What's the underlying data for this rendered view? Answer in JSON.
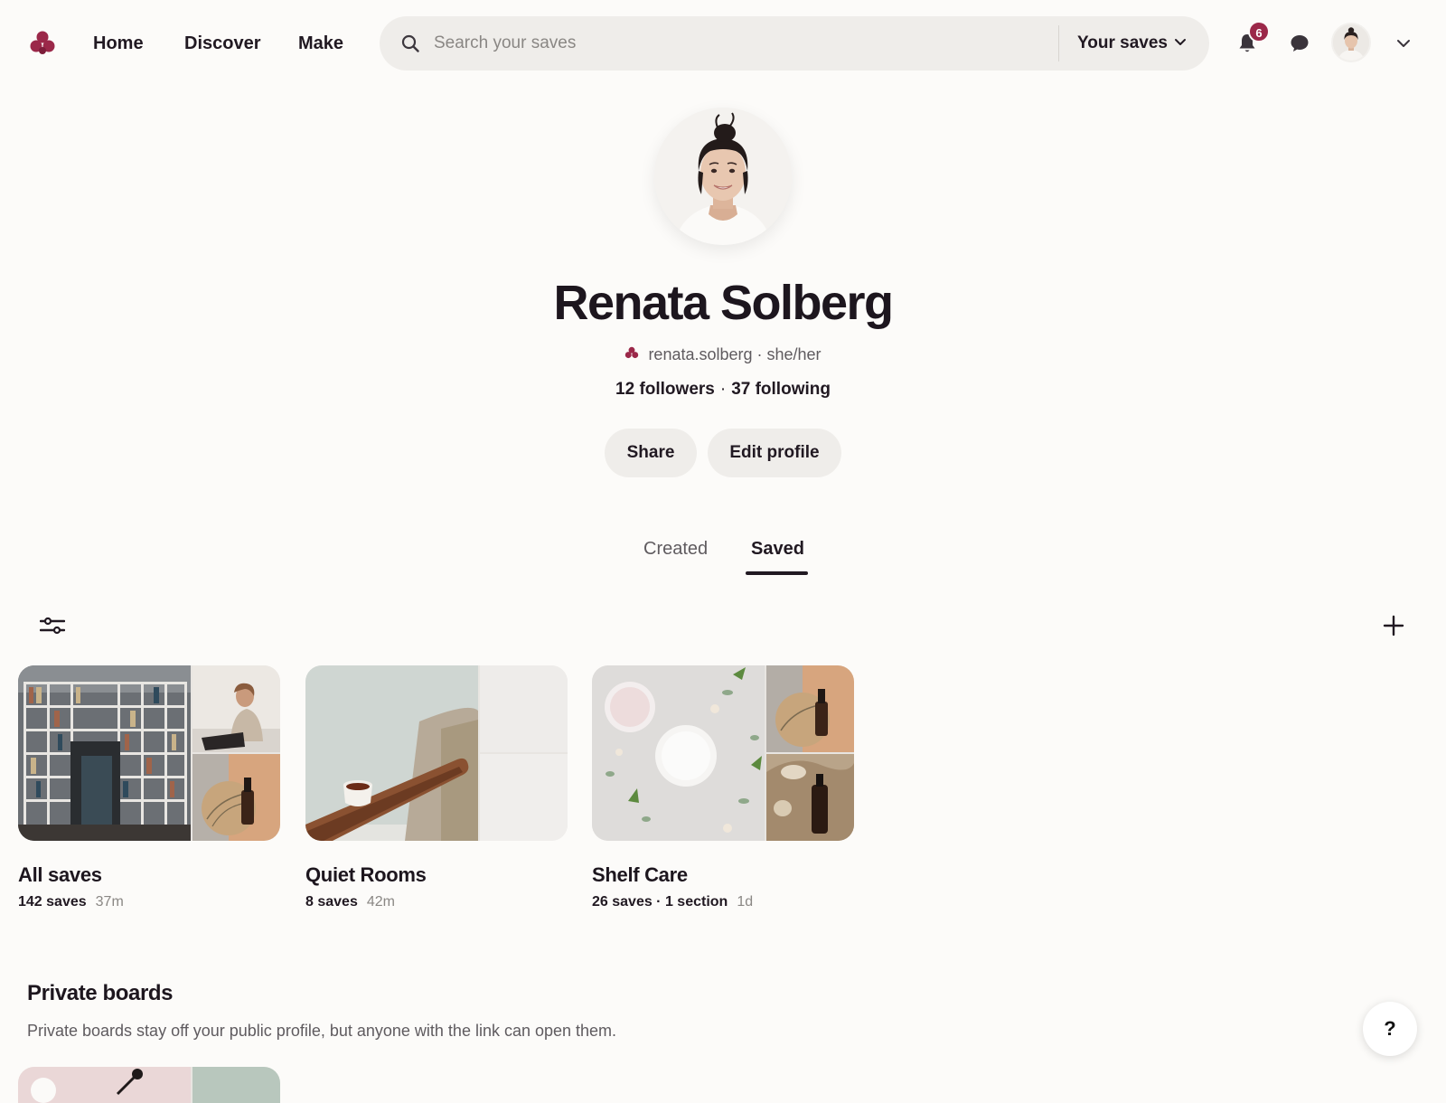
{
  "header": {
    "nav": [
      {
        "label": "Home"
      },
      {
        "label": "Discover"
      },
      {
        "label": "Make"
      }
    ],
    "search": {
      "placeholder": "Search your saves",
      "scope_label": "Your saves"
    },
    "notifications_count": "6",
    "icons": [
      "brand-logo-icon",
      "search-icon",
      "chevron-down-icon",
      "bell-icon",
      "chat-bubble-icon",
      "avatar",
      "chevron-down-icon"
    ]
  },
  "profile": {
    "name": "Renata Solberg",
    "handle_line": "renata.solberg · she/her",
    "followers": "12 followers",
    "following": "37 following",
    "stats_separator": "·",
    "buttons": {
      "share": "Share",
      "edit": "Edit profile"
    }
  },
  "tabs": [
    {
      "label": "Created",
      "active": false
    },
    {
      "label": "Saved",
      "active": true
    }
  ],
  "boards": [
    {
      "title": "All saves",
      "count": "142 saves",
      "ago": "37m"
    },
    {
      "title": "Quiet Rooms",
      "count": "8 saves",
      "ago": "42m"
    },
    {
      "title": "Shelf Care",
      "count": "26 saves · 1 section",
      "ago": "1d"
    }
  ],
  "private_boards": {
    "title": "Private boards",
    "description": "Private boards stay off your public profile, but anyone with the link can open them."
  },
  "help_label": "?",
  "colors": {
    "brand": "#9b2849",
    "background": "#fcfbf9",
    "pill": "#efedea",
    "text": "#211922"
  }
}
